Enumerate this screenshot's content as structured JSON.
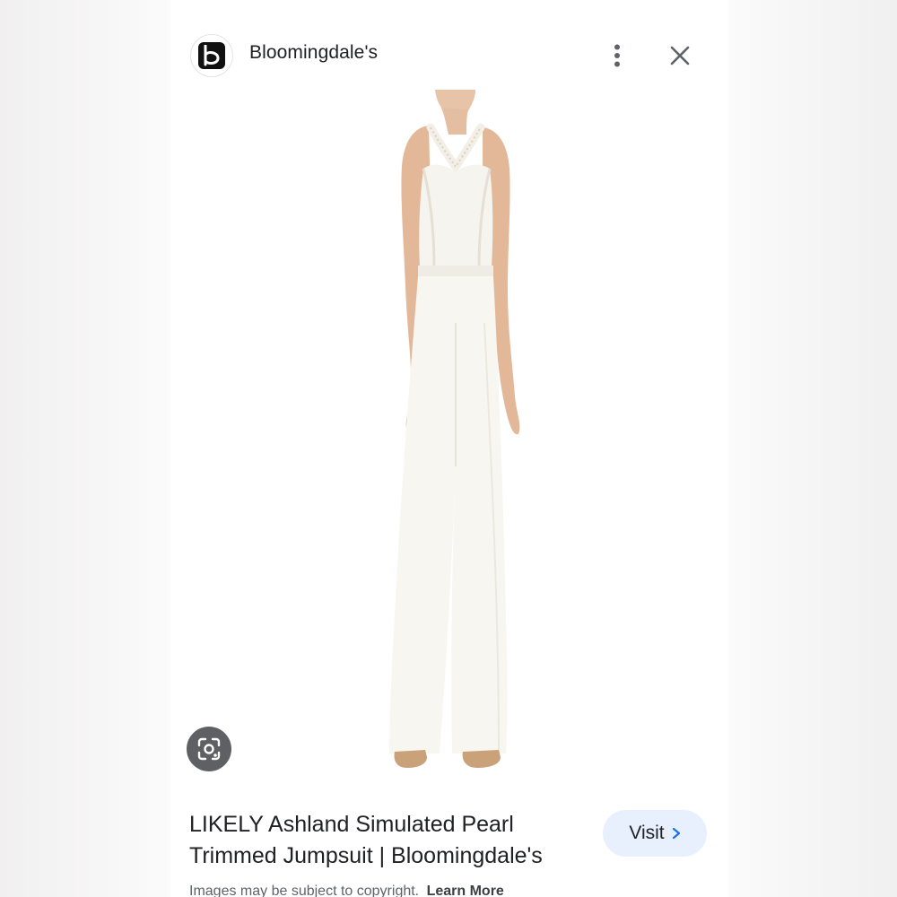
{
  "source": {
    "name": "Bloomingdale's",
    "logo_letter": "b",
    "logo_icon": "bloomingdales-logo-icon"
  },
  "header": {
    "more_icon": "more-vert-icon",
    "close_icon": "close-icon"
  },
  "image": {
    "subject": "white halter jumpsuit with pearl trim",
    "lens_icon": "google-lens-icon"
  },
  "product": {
    "title": "LIKELY Ashland Simulated Pearl Trimmed Jumpsuit | Bloomingdale's"
  },
  "visit_button": {
    "label": "Visit",
    "icon": "chevron-right-icon"
  },
  "footer": {
    "notice": "Images may be subject to copyright.",
    "learn_more": "Learn More"
  },
  "colors": {
    "visit_bg": "#e8f0fe",
    "lens_bg": "#5f6063",
    "text": "#202124"
  }
}
